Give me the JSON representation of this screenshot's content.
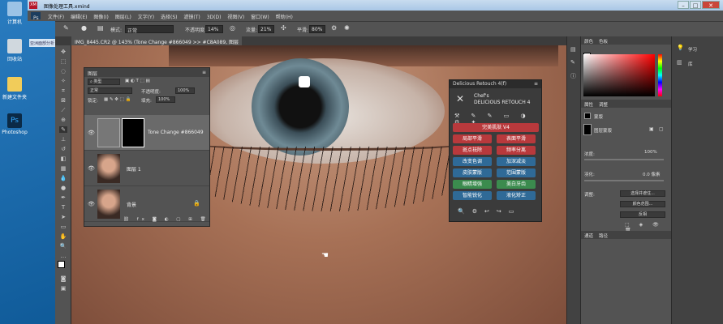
{
  "window": {
    "title": "图像处理工具.xmind"
  },
  "desktop_icons": [
    {
      "label": "计算机"
    },
    {
      "label": "回收站"
    },
    {
      "label": "新建文件夹"
    },
    {
      "label": "Photoshop"
    }
  ],
  "desktop_file": "亚洲面部分析",
  "menu": [
    "文件(F)",
    "编辑(E)",
    "图像(I)",
    "图层(L)",
    "文字(Y)",
    "选择(S)",
    "滤镜(T)",
    "3D(D)",
    "视图(V)",
    "窗口(W)",
    "帮助(H)"
  ],
  "options": {
    "mode_label": "模式:",
    "mode_value": "正常",
    "opacity_label": "不透明度:",
    "opacity_value": "14%",
    "flow_label": "流量:",
    "flow_value": "21%",
    "smooth_label": "平滑:",
    "smooth_value": "80%"
  },
  "doc_tab": "IMG_8445.CR2 @ 143% (Tone Change #866049 >> #C8A089, 图层蒙版/8) *",
  "layers": {
    "title": "图层",
    "kind": "类型",
    "blend": "正常",
    "opacity_label": "不透明度:",
    "opacity_value": "100%",
    "lock_label": "锁定:",
    "fill_label": "填充:",
    "fill_value": "100%",
    "items": [
      {
        "name": "Tone Change #866049"
      },
      {
        "name": "图层 1"
      },
      {
        "name": "背景"
      }
    ]
  },
  "retouch": {
    "title": "Delicious Retouch 4(f)",
    "logo_line1": "Chef's",
    "logo_line2": "DELICIOUS RETOUCH 4",
    "buttons": [
      "完美肌肤 V4",
      "局部平滑",
      "表面平滑",
      "斑点祛除",
      "频率分离",
      "改变色调",
      "加深减淡",
      "皮肤蒙版",
      "范围蒙版",
      "眼睛增强",
      "美白牙齿",
      "智能锐化",
      "液化矫正"
    ]
  },
  "color_panel": {
    "tab1": "颜色",
    "tab2": "色板"
  },
  "right_strip": {
    "learn": "学习",
    "libraries": "库"
  },
  "properties": {
    "tab1": "属性",
    "tab2": "调整",
    "mask_label": "蒙版",
    "layer_mask": "图层蒙版",
    "density_label": "浓度:",
    "density_value": "100%",
    "feather_label": "羽化:",
    "feather_value": "0.0 像素",
    "adjust_label": "调整:",
    "select_subject": "选择并遮住...",
    "color_range": "颜色范围...",
    "invert": "反相"
  },
  "bottom_tabs": {
    "channels": "通道",
    "paths": "路径"
  },
  "colors": {
    "accent": "#31a8ff",
    "red": "#b8393c",
    "blue": "#2f6a97",
    "green": "#3b8b4e"
  }
}
